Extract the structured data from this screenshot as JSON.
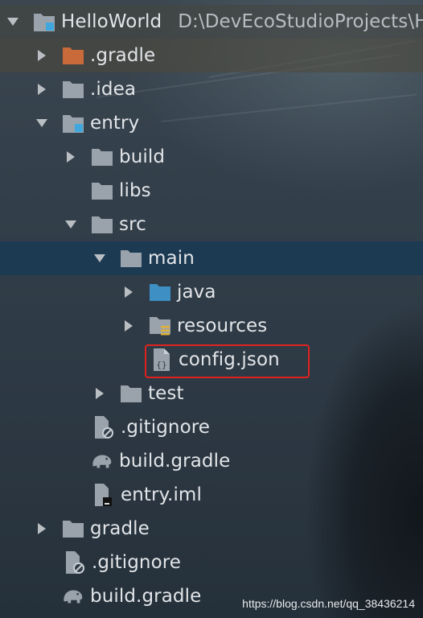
{
  "project": {
    "name": "HelloWorld",
    "path": "D:\\DevEcoStudioProjects\\H"
  },
  "tree": {
    "gradle_hidden": ".gradle",
    "idea": ".idea",
    "entry": "entry",
    "build": "build",
    "libs": "libs",
    "src": "src",
    "main": "main",
    "java": "java",
    "resources": "resources",
    "config_json": "config.json",
    "test": "test",
    "entry_gitignore": ".gitignore",
    "entry_build_gradle": "build.gradle",
    "entry_iml": "entry.iml",
    "gradle": "gradle",
    "root_gitignore": ".gitignore",
    "root_build_gradle": "build.gradle"
  },
  "watermark": "https://blog.csdn.net/qq_38436214",
  "colors": {
    "selected_row": "#1c3a52",
    "highlight_border": "#e0221f",
    "module_badge": "#3fa7de",
    "gradle_folder": "#c96a3a",
    "source_folder": "#3e8fc4"
  },
  "icons": {
    "folder": "folder-icon",
    "module": "module-folder-icon",
    "file": "file-icon",
    "gradle": "gradle-elephant-icon"
  }
}
